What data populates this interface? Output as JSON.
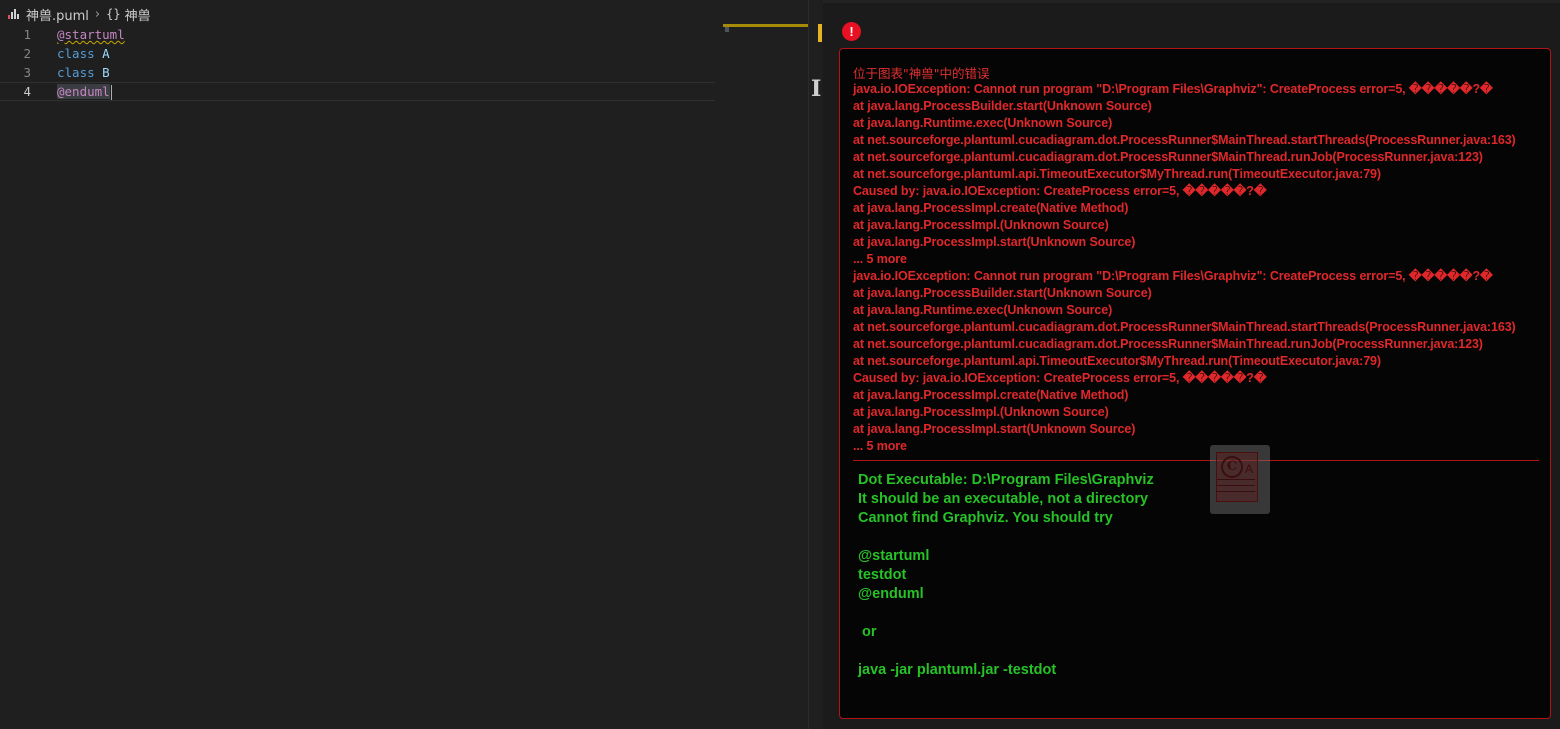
{
  "breadcrumb": {
    "file_name": "神兽.puml",
    "symbol_braces": "{}",
    "symbol_name": "神兽"
  },
  "editor": {
    "lines": [
      {
        "number": "1",
        "parts": [
          "@startuml"
        ]
      },
      {
        "number": "2",
        "parts": [
          "class",
          "A"
        ]
      },
      {
        "number": "3",
        "parts": [
          "class",
          "B"
        ]
      },
      {
        "number": "4",
        "parts": [
          "@enduml"
        ]
      }
    ],
    "active_line": 4
  },
  "preview": {
    "error_icon_glyph": "!",
    "error_title": "位于图表\"神兽\"中的错误",
    "stack_trace": [
      "java.io.IOException: Cannot run program \"D:\\Program Files\\Graphviz\": CreateProcess error=5, �����?�",
      "at java.lang.ProcessBuilder.start(Unknown Source)",
      "at java.lang.Runtime.exec(Unknown Source)",
      "at net.sourceforge.plantuml.cucadiagram.dot.ProcessRunner$MainThread.startThreads(ProcessRunner.java:163)",
      "at net.sourceforge.plantuml.cucadiagram.dot.ProcessRunner$MainThread.runJob(ProcessRunner.java:123)",
      "at net.sourceforge.plantuml.api.TimeoutExecutor$MyThread.run(TimeoutExecutor.java:79)",
      "Caused by: java.io.IOException: CreateProcess error=5, �����?�",
      "at java.lang.ProcessImpl.create(Native Method)",
      "at java.lang.ProcessImpl.(Unknown Source)",
      "at java.lang.ProcessImpl.start(Unknown Source)",
      "... 5 more",
      "java.io.IOException: Cannot run program \"D:\\Program Files\\Graphviz\": CreateProcess error=5, �����?�",
      "at java.lang.ProcessBuilder.start(Unknown Source)",
      "at java.lang.Runtime.exec(Unknown Source)",
      "at net.sourceforge.plantuml.cucadiagram.dot.ProcessRunner$MainThread.startThreads(ProcessRunner.java:163)",
      "at net.sourceforge.plantuml.cucadiagram.dot.ProcessRunner$MainThread.runJob(ProcessRunner.java:123)",
      "at net.sourceforge.plantuml.api.TimeoutExecutor$MyThread.run(TimeoutExecutor.java:79)",
      "Caused by: java.io.IOException: CreateProcess error=5, �����?�",
      "at java.lang.ProcessImpl.create(Native Method)",
      "at java.lang.ProcessImpl.(Unknown Source)",
      "at java.lang.ProcessImpl.start(Unknown Source)",
      "... 5 more"
    ],
    "help_lines": [
      "Dot Executable: D:\\Program Files\\Graphviz",
      "It should be an executable, not a directory",
      "Cannot find Graphviz. You should try",
      "",
      "@startuml",
      "testdot",
      "@enduml",
      "",
      " or",
      "",
      "java -jar plantuml.jar -testdot"
    ],
    "overlay_badge": {
      "circle_letter": "C",
      "side_letter": "A"
    }
  },
  "colors": {
    "error_red": "#e0282a",
    "help_green": "#27c227",
    "editor_bg": "#1f1f1f",
    "preview_bg": "#050505"
  }
}
